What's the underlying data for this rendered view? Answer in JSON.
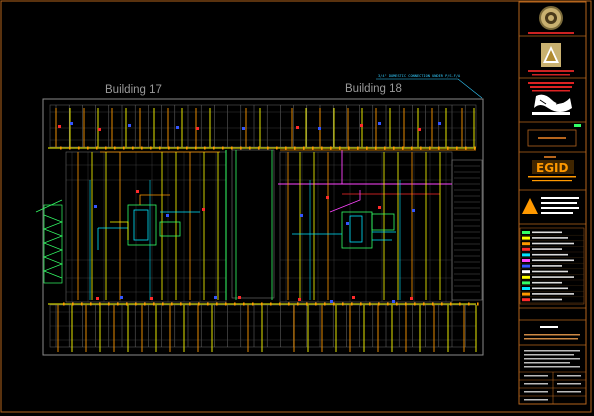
{
  "drawing": {
    "building_17_label": "Building 17",
    "building_18_label": "Building 18",
    "connection_note": "3/4\" DOMESTIC CONNECTION UNDER P/S-F/A"
  },
  "title_block": {
    "logo_word": "EGID"
  },
  "colors": {
    "background": "#000000",
    "frame": "#b5651d",
    "walls": "#8a8a8a",
    "pipe_primary": "#ffff00",
    "pipe_secondary": "#ff9900",
    "pipe_red": "#ff2a2a",
    "pipe_green": "#33ff66",
    "pipe_cyan": "#00e5ff",
    "pipe_magenta": "#ff44ff",
    "pipe_blue": "#3355ff"
  },
  "icons": [
    "seal-emblem-icon",
    "triangle-logo-icon",
    "logo-mark-icon",
    "warning-triangle-icon"
  ]
}
